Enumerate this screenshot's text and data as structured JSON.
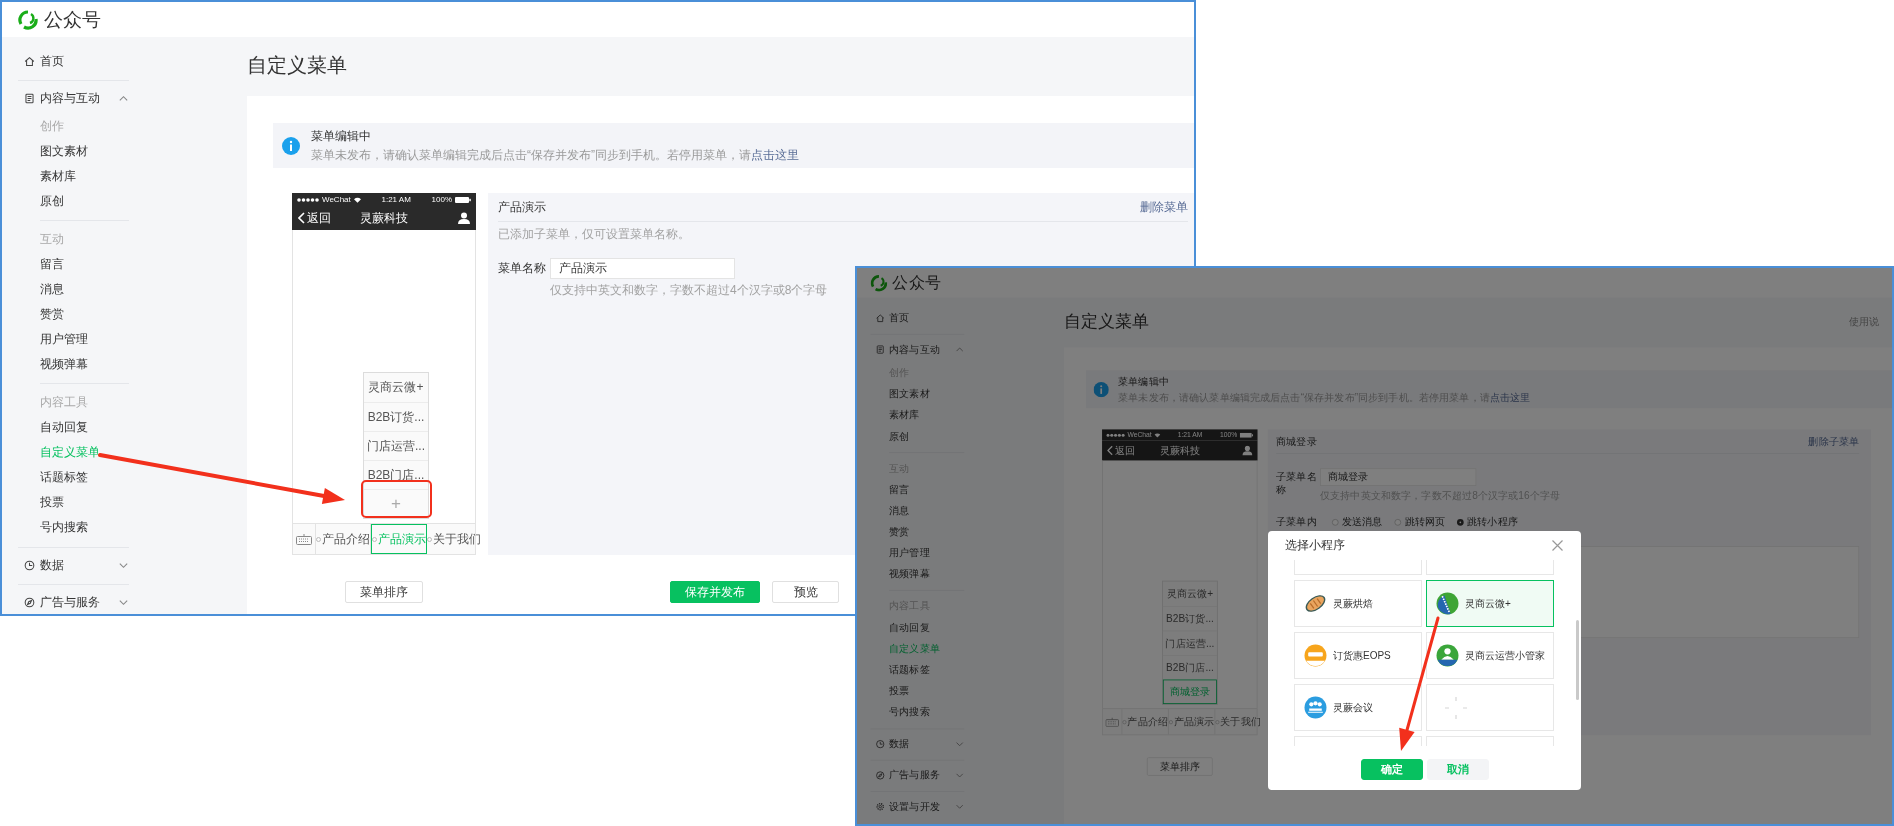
{
  "left_window": {
    "logo_text": "公众号",
    "sidebar": [
      {
        "label": "首页"
      },
      {
        "label": "内容与互动",
        "expanded": true,
        "sections": [
          {
            "heading": "创作",
            "items": [
              {
                "label": "图文素材",
                "selected": false
              },
              {
                "label": "素材库",
                "selected": false
              },
              {
                "label": "原创",
                "selected": false
              }
            ]
          },
          {
            "heading": "互动",
            "items": [
              {
                "label": "留言",
                "selected": false
              },
              {
                "label": "消息",
                "selected": false
              },
              {
                "label": "赞赏",
                "selected": false
              },
              {
                "label": "用户管理",
                "selected": false
              },
              {
                "label": "视频弹幕",
                "selected": false
              }
            ]
          },
          {
            "heading": "内容工具",
            "items": [
              {
                "label": "自动回复",
                "selected": false
              },
              {
                "label": "自定义菜单",
                "selected": true
              },
              {
                "label": "话题标签",
                "selected": false
              },
              {
                "label": "投票",
                "selected": false
              },
              {
                "label": "号内搜索",
                "selected": false
              }
            ]
          }
        ]
      },
      {
        "label": "数据",
        "expanded": false
      },
      {
        "label": "广告与服务",
        "expanded": false
      }
    ],
    "page_title": "自定义菜单",
    "notice": {
      "title": "菜单编辑中",
      "text": "菜单未发布，请确认菜单编辑完成后点击“保存并发布”同步到手机。若停用菜单，请",
      "link": "点击这里"
    },
    "phone": {
      "carrier": "WeChat",
      "time": "1:21 AM",
      "battery": "100%",
      "back": "返回",
      "title": "灵蕨科技",
      "submenu": [
        {
          "kind": "item",
          "label": "灵商云微+",
          "selected": false
        },
        {
          "kind": "item",
          "label": "B2B订货...",
          "selected": false
        },
        {
          "kind": "item",
          "label": "门店运营...",
          "selected": false
        },
        {
          "kind": "item",
          "label": "B2B门店...",
          "selected": false
        },
        {
          "kind": "add",
          "label": "+",
          "selected": false
        }
      ],
      "tabs": [
        {
          "label": "产品介绍",
          "selected": false
        },
        {
          "label": "产品演示",
          "selected": true
        },
        {
          "label": "关于我们",
          "selected": false
        }
      ]
    },
    "editor": {
      "title": "产品演示",
      "delete_link": "删除菜单",
      "note": "已添加子菜单，仅可设置菜单名称。",
      "name_label": "菜单名称",
      "name_value": "产品演示",
      "hint": "仅支持中英文和数字，字数不超过4个汉字或8个字母"
    },
    "buttons": [
      {
        "label": "菜单排序",
        "kind": "default"
      },
      {
        "label": "保存并发布",
        "kind": "primary"
      },
      {
        "label": "预览",
        "kind": "default"
      }
    ]
  },
  "right_window": {
    "logo_text": "公众号",
    "sidebar": [
      {
        "label": "首页"
      },
      {
        "label": "内容与互动",
        "expanded": true,
        "sections": [
          {
            "heading": "创作",
            "items": [
              {
                "label": "图文素材",
                "selected": false
              },
              {
                "label": "素材库",
                "selected": false
              },
              {
                "label": "原创",
                "selected": false
              }
            ]
          },
          {
            "heading": "互动",
            "items": [
              {
                "label": "留言",
                "selected": false
              },
              {
                "label": "消息",
                "selected": false
              },
              {
                "label": "赞赏",
                "selected": false
              },
              {
                "label": "用户管理",
                "selected": false
              },
              {
                "label": "视频弹幕",
                "selected": false
              }
            ]
          },
          {
            "heading": "内容工具",
            "items": [
              {
                "label": "自动回复",
                "selected": false
              },
              {
                "label": "自定义菜单",
                "selected": true
              },
              {
                "label": "话题标签",
                "selected": false
              },
              {
                "label": "投票",
                "selected": false
              },
              {
                "label": "号内搜索",
                "selected": false
              }
            ]
          }
        ]
      },
      {
        "label": "数据",
        "expanded": false
      },
      {
        "label": "广告与服务",
        "expanded": false
      },
      {
        "label": "设置与开发",
        "expanded": false
      }
    ],
    "page_title": "自定义菜单",
    "help_link": "使用说",
    "notice": {
      "title": "菜单编辑中",
      "text": "菜单未发布，请确认菜单编辑完成后点击“保存并发布”同步到手机。若停用菜单，请",
      "link": "点击这里"
    },
    "phone": {
      "carrier": "WeChat",
      "time": "1:21 AM",
      "battery": "100%",
      "back": "返回",
      "title": "灵蕨科技",
      "submenu": [
        {
          "kind": "item",
          "label": "灵商云微+",
          "selected": false
        },
        {
          "kind": "item",
          "label": "B2B订货...",
          "selected": false
        },
        {
          "kind": "item",
          "label": "门店运营...",
          "selected": false
        },
        {
          "kind": "item",
          "label": "B2B门店...",
          "selected": false
        },
        {
          "kind": "item",
          "label": "商城登录",
          "selected": true
        }
      ],
      "tabs": [
        {
          "label": "产品介绍",
          "selected": false
        },
        {
          "label": "产品演示",
          "selected": false
        },
        {
          "label": "关于我们",
          "selected": false
        }
      ]
    },
    "editor": {
      "title": "商城登录",
      "delete_link": "删除子菜单",
      "name_label": "子菜单名称",
      "name_value": "商城登录",
      "hint": "仅支持中英文和数字，字数不超过8个汉字或16个字母",
      "content_label": "子菜单内",
      "options": [
        {
          "label": "发送消息",
          "selected": false
        },
        {
          "label": "跳转网页",
          "selected": false
        },
        {
          "label": "跳转小程序",
          "selected": true
        }
      ]
    },
    "buttons": [
      {
        "label": "菜单排序",
        "kind": "default"
      }
    ],
    "dialog": {
      "title": "选择小程序",
      "apps": [
        {
          "kind": "app",
          "name": "灵蕨烘焙",
          "selected": false
        },
        {
          "kind": "app",
          "name": "灵商云微+",
          "selected": true
        },
        {
          "kind": "app",
          "name": "订货惠EOPS",
          "selected": false
        },
        {
          "kind": "app",
          "name": "灵商云运营小管家",
          "selected": false
        },
        {
          "kind": "app",
          "name": "灵蕨会议",
          "selected": false
        },
        {
          "kind": "loading",
          "selected": false
        }
      ],
      "buttons": [
        {
          "label": "确定",
          "kind": "primary"
        },
        {
          "label": "取消",
          "kind": "secondary"
        }
      ]
    }
  }
}
